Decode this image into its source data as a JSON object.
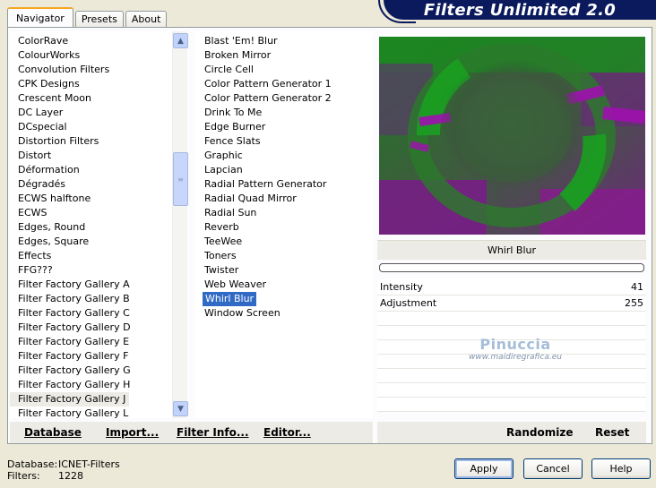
{
  "tabs": [
    "Navigator",
    "Presets",
    "About"
  ],
  "banner_title": "Filters Unlimited 2.0",
  "categories": [
    "ColorRave",
    "ColourWorks",
    "Convolution Filters",
    "CPK Designs",
    "Crescent Moon",
    "DC Layer",
    "DCspecial",
    "Distortion Filters",
    "Distort",
    "Déformation",
    "Dégradés",
    "ECWS halftone",
    "ECWS",
    "Edges, Round",
    "Edges, Square",
    "Effects",
    "FFG???",
    "Filter Factory Gallery A",
    "Filter Factory Gallery B",
    "Filter Factory Gallery C",
    "Filter Factory Gallery D",
    "Filter Factory Gallery E",
    "Filter Factory Gallery F",
    "Filter Factory Gallery G",
    "Filter Factory Gallery H",
    "Filter Factory Gallery J",
    "Filter Factory Gallery L"
  ],
  "highlighted_category": "Filter Factory Gallery J",
  "filters": [
    "Blast 'Em! Blur",
    "Broken Mirror",
    "Circle Cell",
    "Color Pattern Generator 1",
    "Color Pattern Generator 2",
    "Drink To Me",
    "Edge Burner",
    "Fence Slats",
    "Graphic",
    "Lapcian",
    "Radial Pattern Generator",
    "Radial Quad Mirror",
    "Radial Sun",
    "Reverb",
    "TeeWee",
    "Toners",
    "Twister",
    "Web Weaver",
    "Whirl Blur",
    "Window Screen"
  ],
  "selected_filter": "Whirl Blur",
  "filter_title": "Whirl Blur",
  "params": [
    {
      "label": "Intensity",
      "value": "41"
    },
    {
      "label": "Adjustment",
      "value": "255"
    }
  ],
  "watermark": {
    "name": "Pinuccia",
    "url": "www.maidiregrafica.eu"
  },
  "bottom_links": {
    "database": "Database",
    "import": "Import...",
    "filter_info": "Filter Info...",
    "editor": "Editor...",
    "randomize": "Randomize",
    "reset": "Reset"
  },
  "info": {
    "database_label": "Database:",
    "database_value": "ICNET-Filters",
    "filters_label": "Filters:",
    "filters_value": "1228"
  },
  "buttons": {
    "apply": "Apply",
    "cancel": "Cancel",
    "help": "Help"
  },
  "colors": {
    "selection": "#316ac5",
    "banner": "#0a1a5c",
    "preview_green": "#1a8a1a",
    "preview_purple": "#8a1a8a"
  }
}
